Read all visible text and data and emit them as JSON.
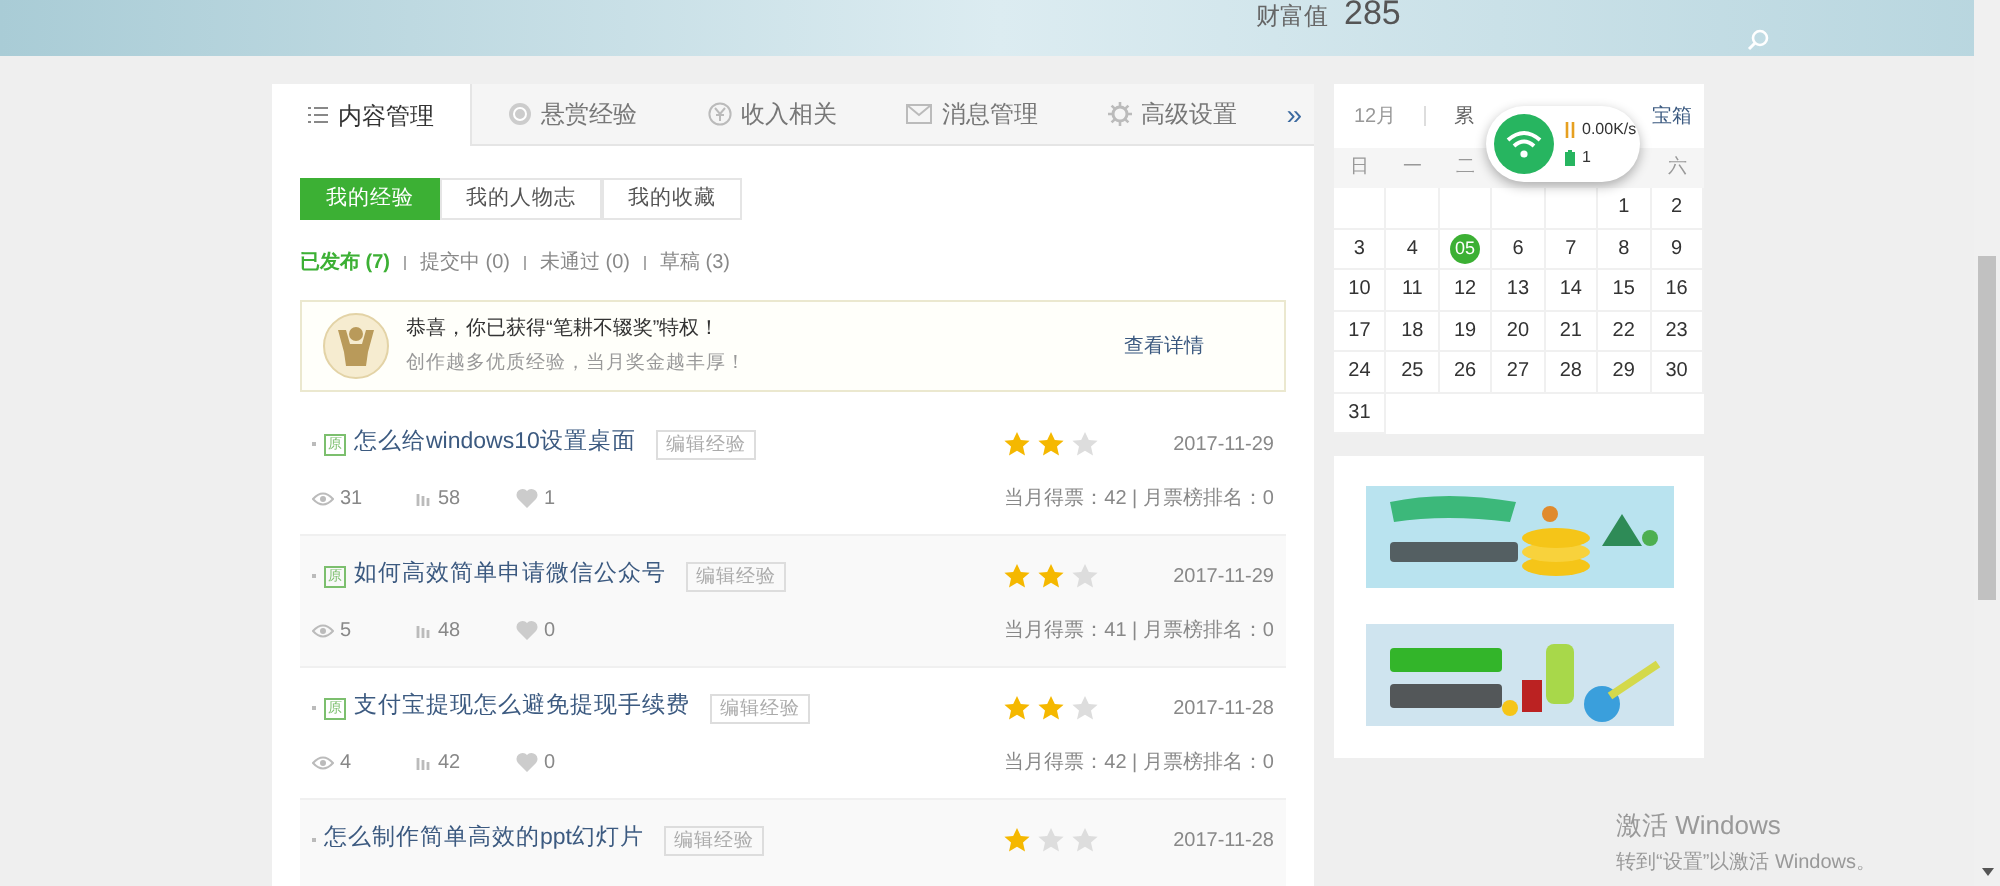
{
  "header": {
    "wealth_label": "财富值",
    "wealth_value": "285"
  },
  "tabs": [
    {
      "label": "内容管理",
      "selected": true
    },
    {
      "label": "悬赏经验",
      "selected": false
    },
    {
      "label": "收入相关",
      "selected": false
    },
    {
      "label": "消息管理",
      "selected": false
    },
    {
      "label": "高级设置",
      "selected": false
    }
  ],
  "more_tabs": "»",
  "sub_tabs": [
    {
      "label": "我的经验",
      "selected": true
    },
    {
      "label": "我的人物志",
      "selected": false
    },
    {
      "label": "我的收藏",
      "selected": false
    }
  ],
  "filters": [
    {
      "label": "已发布 (7)",
      "selected": true
    },
    {
      "label": "提交中 (0)",
      "selected": false
    },
    {
      "label": "未通过 (0)",
      "selected": false
    },
    {
      "label": "草稿 (3)",
      "selected": false
    }
  ],
  "notice": {
    "title": "恭喜，你已获得“笔耕不辍奖”特权！",
    "subtitle": "创作越多优质经验，当月奖金越丰厚！",
    "link": "查看详情"
  },
  "items": [
    {
      "title": "怎么给windows10设置桌面",
      "original": true,
      "badge": "原",
      "edit": "编辑经验",
      "stars": 2,
      "date": "2017-11-29",
      "views": "31",
      "votes": "58",
      "likes": "1",
      "stats": "当月得票：42 | 月票榜排名：0"
    },
    {
      "title": "如何高效简单申请微信公众号",
      "original": true,
      "badge": "原",
      "edit": "编辑经验",
      "stars": 2,
      "date": "2017-11-29",
      "views": "5",
      "votes": "48",
      "likes": "0",
      "stats": "当月得票：41 | 月票榜排名：0"
    },
    {
      "title": "支付宝提现怎么避免提现手续费",
      "original": true,
      "badge": "原",
      "edit": "编辑经验",
      "stars": 2,
      "date": "2017-11-28",
      "views": "4",
      "votes": "42",
      "likes": "0",
      "stats": "当月得票：42 | 月票榜排名：0"
    },
    {
      "title": "怎么制作简单高效的ppt幻灯片",
      "original": false,
      "edit": "编辑经验",
      "stars": 1,
      "date": "2017-11-28"
    }
  ],
  "calendar": {
    "month": "12月",
    "summary_left": "累",
    "summary_right": "宝箱",
    "weekdays": [
      "日",
      "一",
      "二",
      "六"
    ],
    "days": [
      {
        "kind": "blank"
      },
      {
        "kind": "blank"
      },
      {
        "kind": "blank"
      },
      {
        "kind": "blank"
      },
      {
        "kind": "blank"
      },
      {
        "kind": "day",
        "label": "1",
        "selected": false
      },
      {
        "kind": "day",
        "label": "2",
        "selected": false
      },
      {
        "kind": "day",
        "label": "3",
        "selected": false
      },
      {
        "kind": "day",
        "label": "4",
        "selected": false
      },
      {
        "kind": "day",
        "label": "05",
        "selected": true
      },
      {
        "kind": "day",
        "label": "6",
        "selected": false
      },
      {
        "kind": "day",
        "label": "7",
        "selected": false
      },
      {
        "kind": "day",
        "label": "8",
        "selected": false
      },
      {
        "kind": "day",
        "label": "9",
        "selected": false
      },
      {
        "kind": "day",
        "label": "10",
        "selected": false
      },
      {
        "kind": "day",
        "label": "11",
        "selected": false
      },
      {
        "kind": "day",
        "label": "12",
        "selected": false
      },
      {
        "kind": "day",
        "label": "13",
        "selected": false
      },
      {
        "kind": "day",
        "label": "14",
        "selected": false
      },
      {
        "kind": "day",
        "label": "15",
        "selected": false
      },
      {
        "kind": "day",
        "label": "16",
        "selected": false
      },
      {
        "kind": "day",
        "label": "17",
        "selected": false
      },
      {
        "kind": "day",
        "label": "18",
        "selected": false
      },
      {
        "kind": "day",
        "label": "19",
        "selected": false
      },
      {
        "kind": "day",
        "label": "20",
        "selected": false
      },
      {
        "kind": "day",
        "label": "21",
        "selected": false
      },
      {
        "kind": "day",
        "label": "22",
        "selected": false
      },
      {
        "kind": "day",
        "label": "23",
        "selected": false
      },
      {
        "kind": "day",
        "label": "24",
        "selected": false
      },
      {
        "kind": "day",
        "label": "25",
        "selected": false
      },
      {
        "kind": "day",
        "label": "26",
        "selected": false
      },
      {
        "kind": "day",
        "label": "27",
        "selected": false
      },
      {
        "kind": "day",
        "label": "28",
        "selected": false
      },
      {
        "kind": "day",
        "label": "29",
        "selected": false
      },
      {
        "kind": "day",
        "label": "30",
        "selected": false
      },
      {
        "kind": "day",
        "label": "31",
        "selected": false
      }
    ]
  },
  "network_popup": {
    "speed": "0.00K/s",
    "count": "1"
  },
  "activation": {
    "title": "激活 Windows",
    "hint": "转到“设置”以激活 Windows。"
  }
}
